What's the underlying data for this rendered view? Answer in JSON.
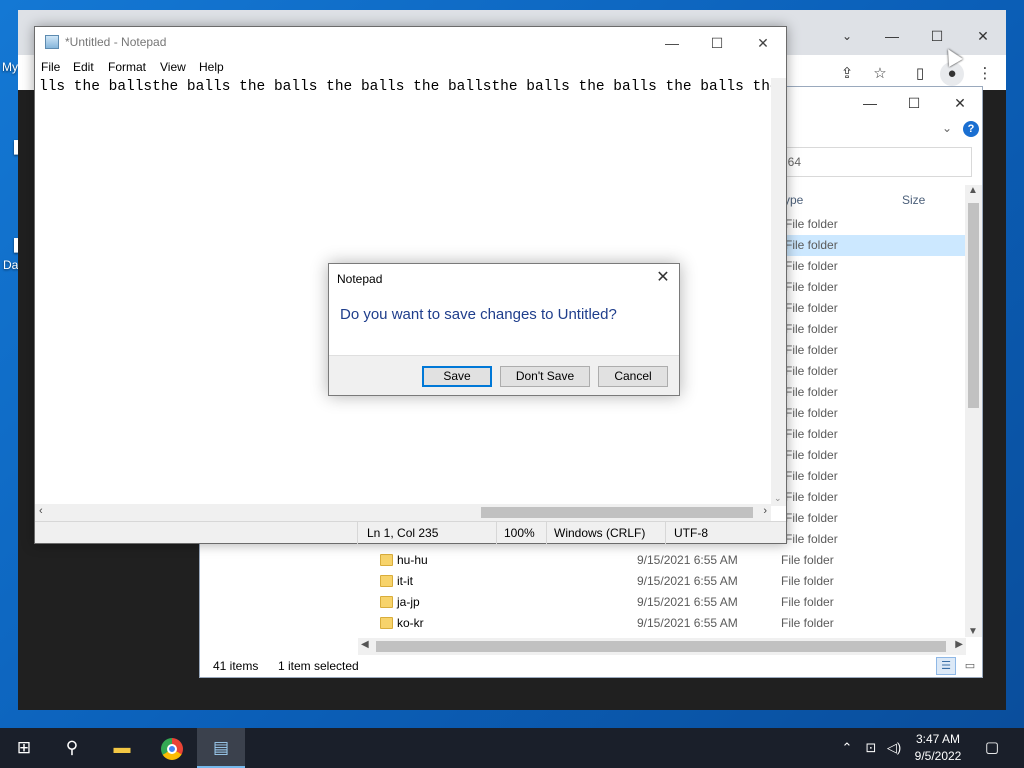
{
  "desktop": {
    "icon_label_1": "My",
    "icon_label_2": "Da"
  },
  "chrome": {
    "minimize": "—",
    "maximize": "☐",
    "close": "✕",
    "toolbar_icons": [
      "share-icon",
      "star-icon",
      "sidepanel-icon",
      "profile-icon",
      "more-icon"
    ]
  },
  "explorer": {
    "minimize": "—",
    "maximize": "☐",
    "close": "✕",
    "search_value": "l64",
    "help_label": "?",
    "columns": {
      "type": "ype",
      "size": "Size"
    },
    "partial_rows": [
      {
        "type": "File folder"
      },
      {
        "type": "File folder"
      },
      {
        "type": "File folder"
      },
      {
        "type": "File folder"
      },
      {
        "type": "File folder"
      },
      {
        "type": "File folder"
      },
      {
        "type": "File folder"
      },
      {
        "type": "File folder"
      },
      {
        "type": "File folder"
      },
      {
        "type": "File folder"
      },
      {
        "type": "File folder"
      },
      {
        "type": "File folder"
      },
      {
        "type": "File folder"
      },
      {
        "type": "File folder"
      },
      {
        "type": "File folder"
      },
      {
        "type": "File folder"
      }
    ],
    "rows": [
      {
        "name": "hu-hu",
        "date": "9/15/2021 6:55 AM",
        "type": "File folder"
      },
      {
        "name": "it-it",
        "date": "9/15/2021 6:55 AM",
        "type": "File folder"
      },
      {
        "name": "ja-jp",
        "date": "9/15/2021 6:55 AM",
        "type": "File folder"
      },
      {
        "name": "ko-kr",
        "date": "9/15/2021 6:55 AM",
        "type": "File folder"
      }
    ],
    "status": {
      "items": "41 items",
      "selected": "1 item selected"
    }
  },
  "notepad": {
    "title": "*Untitled - Notepad",
    "minimize": "—",
    "maximize": "☐",
    "close": "✕",
    "menu": [
      "File",
      "Edit",
      "Format",
      "View",
      "Help"
    ],
    "content": "lls the ballsthe balls the balls the balls the ballsthe balls the balls the balls the balls",
    "status": {
      "position": "Ln 1, Col 235",
      "zoom": "100%",
      "line_ending": "Windows (CRLF)",
      "encoding": "UTF-8"
    }
  },
  "dialog": {
    "title": "Notepad",
    "close": "✕",
    "message": "Do you want to save changes to Untitled?",
    "save": "Save",
    "dont_save": "Don't Save",
    "cancel": "Cancel"
  },
  "taskbar": {
    "time": "3:47 AM",
    "date": "9/5/2022"
  }
}
